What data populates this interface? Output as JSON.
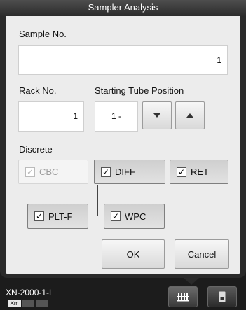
{
  "window": {
    "title": "Sampler Analysis"
  },
  "sample": {
    "label": "Sample No.",
    "value": "1"
  },
  "rack": {
    "label": "Rack No.",
    "value": "1"
  },
  "tube": {
    "label": "Starting Tube Position",
    "value": "1 -"
  },
  "discrete": {
    "label": "Discrete",
    "items": [
      {
        "label": "CBC",
        "checked": true,
        "enabled": false
      },
      {
        "label": "DIFF",
        "checked": true,
        "enabled": true
      },
      {
        "label": "RET",
        "checked": true,
        "enabled": true
      },
      {
        "label": "PLT-F",
        "checked": true,
        "enabled": true
      },
      {
        "label": "WPC",
        "checked": true,
        "enabled": true
      }
    ],
    "check_glyph": "✓"
  },
  "actions": {
    "ok": "OK",
    "cancel": "Cancel"
  },
  "footer": {
    "device": "XN-2000-1-L",
    "modules": [
      "Xm",
      "",
      ""
    ],
    "icons": [
      "sampler-icon",
      "device-icon"
    ]
  }
}
